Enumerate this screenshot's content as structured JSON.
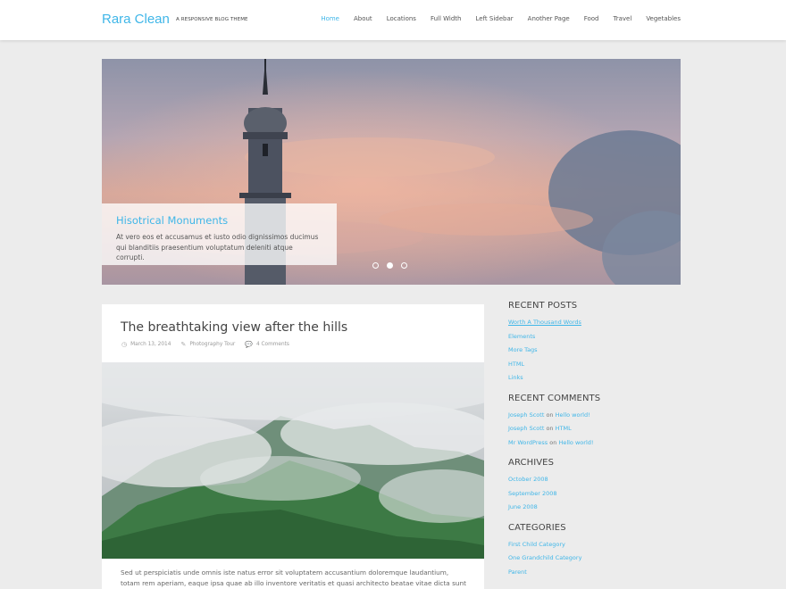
{
  "site": {
    "title": "Rara Clean",
    "description": "A Responsive Blog Theme"
  },
  "nav": {
    "items": [
      "Home",
      "About",
      "Locations",
      "Full Width",
      "Left Sidebar",
      "Another Page",
      "Food",
      "Travel",
      "Vegetables"
    ],
    "active": "Home"
  },
  "slider": {
    "caption_title": "Hisotrical Monuments",
    "caption_text": "At vero eos et accusamus et iusto odio dignissimos ducimus qui blanditiis praesentium voluptatum deleniti atque corrupti.",
    "dot_count": 3,
    "active_dot": 2
  },
  "post": {
    "title": "The breathtaking view after the hills",
    "date": "March 13, 2014",
    "category": "Photography Tour",
    "comments": "4 Comments",
    "excerpt": "Sed ut perspiciatis unde omnis iste natus error sit voluptatem accusantium doloremque laudantium, totam rem aperiam, eaque ipsa quae ab illo inventore veritatis et quasi architecto beatae vitae dicta sunt"
  },
  "sidebar": {
    "recent_posts": {
      "title": "Recent Posts",
      "items": [
        "Worth A Thousand Words",
        "Elements",
        "More Tags",
        "HTML",
        "Links"
      ]
    },
    "recent_comments": {
      "title": "Recent Comments",
      "on": "on",
      "items": [
        {
          "author": "Joseph Scott",
          "post": "Hello world!"
        },
        {
          "author": "Joseph Scott",
          "post": "HTML"
        },
        {
          "author": "Mr WordPress",
          "post": "Hello world!"
        }
      ]
    },
    "archives": {
      "title": "Archives",
      "items": [
        "October 2008",
        "September 2008",
        "June 2008"
      ]
    },
    "categories": {
      "title": "Categories",
      "items": [
        "First Child Category",
        "One Grandchild Category",
        "Parent"
      ]
    }
  },
  "colors": {
    "accent": "#3fb6e8",
    "background": "#ececec"
  }
}
